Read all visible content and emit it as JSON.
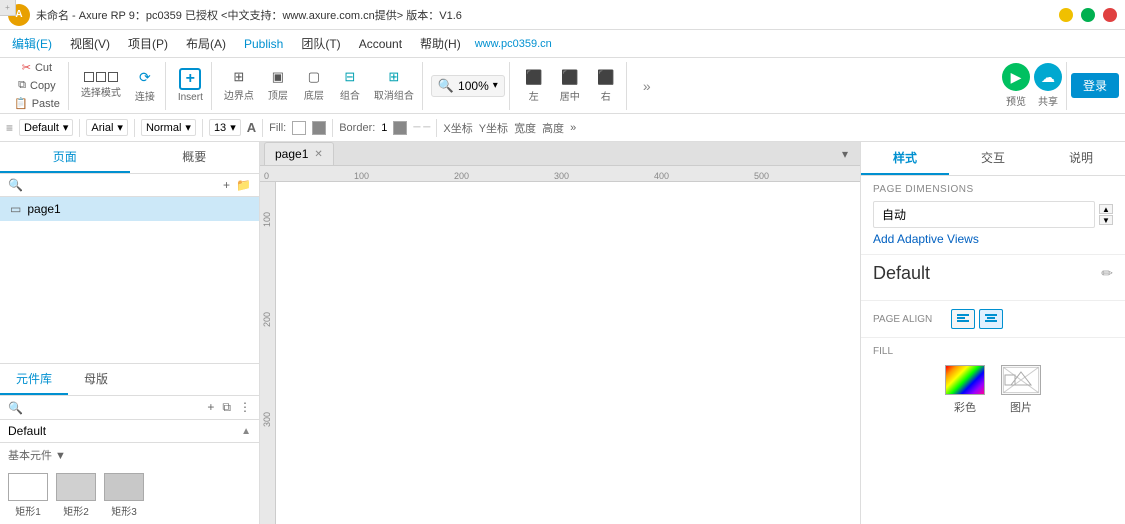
{
  "titleBar": {
    "title": "未命名 - Axure RP 9：pc0359 已授权  <中文支持：www.axure.com.cn提供> 版本：V1.6",
    "minBtn": "─",
    "maxBtn": "□",
    "closeBtn": "✕"
  },
  "menuBar": {
    "items": [
      {
        "id": "file",
        "label": "编辑(E)"
      },
      {
        "id": "view",
        "label": "视图(V)"
      },
      {
        "id": "project",
        "label": "项目(P)"
      },
      {
        "id": "layout",
        "label": "布局(A)"
      },
      {
        "id": "publish",
        "label": "Publish"
      },
      {
        "id": "team",
        "label": "团队(T)"
      },
      {
        "id": "account",
        "label": "Account"
      },
      {
        "id": "help",
        "label": "帮助(H)"
      }
    ],
    "watermark": "www.pc0359.cn"
  },
  "toolbar": {
    "cut": "Cut",
    "copy": "Copy",
    "paste": "Paste",
    "selectMode": "选择模式",
    "connect": "连接",
    "insert": "Insert",
    "border": "边界点",
    "top": "顶层",
    "bottom": "底层",
    "group": "组合",
    "ungroup": "取消组合",
    "zoom": "100%",
    "left": "左",
    "center": "居中",
    "right": "右",
    "preview": "预览",
    "share": "共享",
    "login": "登录",
    "more": "»"
  },
  "formatBar": {
    "style": "Default",
    "font": "Arial",
    "weight": "Normal",
    "size": "13",
    "textLabel": "A",
    "fillLabel": "Fill:",
    "borderLabel": "Border:",
    "borderSize": "1",
    "xLabel": "X坐标",
    "yLabel": "Y坐标",
    "wLabel": "宽度",
    "hLabel": "高度",
    "more": "»"
  },
  "leftPanel": {
    "tab1": "页面",
    "tab2": "概要",
    "searchPlaceholder": "",
    "pages": [
      {
        "id": "page1",
        "label": "page1"
      }
    ],
    "libraryTabs": [
      "元件库",
      "母版"
    ],
    "libSearchPlaceholder": "",
    "libSelectLabel": "Default",
    "libBasicLabel": "基本元件 ▼",
    "libItems": [
      {
        "label": "矩形1",
        "type": "white"
      },
      {
        "label": "矩形2",
        "type": "gray"
      },
      {
        "label": "矩形3",
        "type": "gray2"
      }
    ]
  },
  "canvas": {
    "tab": "page1",
    "rulers": {
      "marks": [
        "0",
        "100",
        "200",
        "300",
        "400",
        "500"
      ]
    }
  },
  "rightPanel": {
    "tabs": [
      "样式",
      "交互",
      "说明"
    ],
    "activeTab": "样式",
    "pageDimensions": {
      "sectionTitle": "PAGE DIMENSIONS",
      "value": "自动"
    },
    "addAdaptiveViews": "Add Adaptive Views",
    "defaultSection": {
      "title": "Default",
      "editIcon": "✏"
    },
    "pageAlign": {
      "sectionTitle": "PAGE ALIGN",
      "options": [
        "≡",
        "≡"
      ]
    },
    "fill": {
      "sectionTitle": "FILL",
      "colorLabel": "彩色",
      "imageLabel": "图片"
    }
  }
}
